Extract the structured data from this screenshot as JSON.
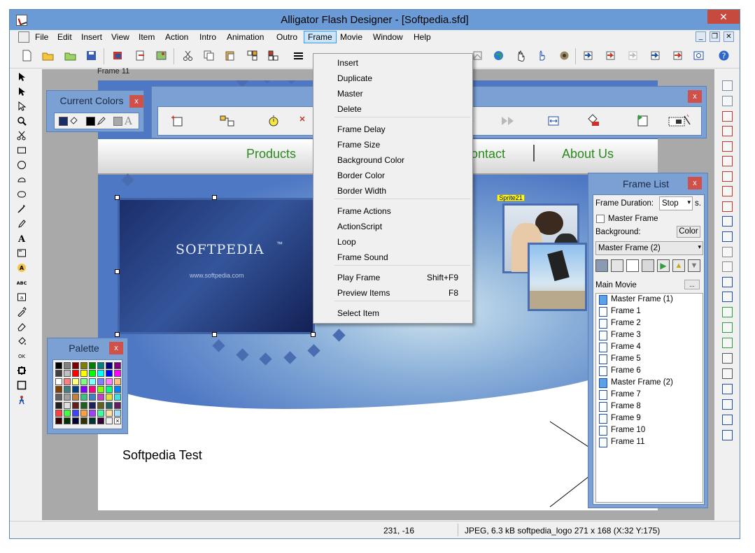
{
  "window": {
    "title": "Alligator Flash Designer - [Softpedia.sfd]",
    "close_glyph": "✕",
    "mdi_minimize": "_",
    "mdi_restore": "❐",
    "mdi_close": "✕"
  },
  "menu": {
    "items": [
      "File",
      "Edit",
      "Insert",
      "View",
      "Item",
      "Action",
      "Intro",
      "Animation",
      "Outro",
      "Frame",
      "Movie",
      "Window",
      "Help"
    ],
    "active": "Frame"
  },
  "frame_menu": {
    "groups": [
      [
        {
          "label": "Insert"
        },
        {
          "label": "Duplicate"
        },
        {
          "label": "Master"
        },
        {
          "label": "Delete"
        }
      ],
      [
        {
          "label": "Frame Delay"
        },
        {
          "label": "Frame Size"
        },
        {
          "label": "Background Color"
        },
        {
          "label": "Border Color"
        },
        {
          "label": "Border Width"
        }
      ],
      [
        {
          "label": "Frame Actions"
        },
        {
          "label": "ActionScript"
        },
        {
          "label": "Loop"
        },
        {
          "label": "Frame Sound"
        }
      ],
      [
        {
          "label": "Play Frame",
          "shortcut": "Shift+F9"
        },
        {
          "label": "Preview Items",
          "shortcut": "F8"
        }
      ],
      [
        {
          "label": "Select Item"
        }
      ]
    ]
  },
  "stage": {
    "frame_label": "Frame 11",
    "nav_links": [
      "Products",
      "Contact",
      "About Us"
    ],
    "sprite_logo": "SOFTPEDIA",
    "sprite_trademark": "™",
    "sprite_url": "www.softpedia.com",
    "sprite_label": "Sprite21",
    "canvas_text": "Softpedia Test"
  },
  "current_colors": {
    "title": "Current Colors",
    "close_glyph": "x",
    "swatches": [
      "#1b2c66",
      "#000000",
      "#a8a8a8"
    ],
    "text_glyph": "A"
  },
  "effects_panel": {
    "close_glyph": "x"
  },
  "palette": {
    "title": "Palette",
    "close_glyph": "x",
    "colors": [
      "#000000",
      "#808080",
      "#800000",
      "#808000",
      "#008000",
      "#008080",
      "#000080",
      "#800080",
      "#404040",
      "#c0c0c0",
      "#ff0000",
      "#ffff00",
      "#00ff00",
      "#00ffff",
      "#0000ff",
      "#ff00ff",
      "#ffffff",
      "#ff8080",
      "#ffff80",
      "#80ff80",
      "#80ffff",
      "#8080ff",
      "#ff80ff",
      "#ffc080",
      "#804000",
      "#408080",
      "#004080",
      "#8000ff",
      "#ff0080",
      "#80ff00",
      "#00ff80",
      "#0080ff",
      "#606060",
      "#a0a0a0",
      "#c08040",
      "#40c080",
      "#4080c0",
      "#c040c0",
      "#e0e040",
      "#40e0e0",
      "#202020",
      "#e0e0e0",
      "#602020",
      "#206020",
      "#202060",
      "#606020",
      "#206060",
      "#602060",
      "#ff4040",
      "#40ff40",
      "#4040ff",
      "#ffa040",
      "#a040ff",
      "#40ffa0",
      "#ffe0a0",
      "#a0e0ff",
      "#300000",
      "#003000",
      "#000030",
      "#303000",
      "#003030",
      "#300030",
      "#f0f0f0"
    ]
  },
  "frame_list": {
    "title": "Frame List",
    "close_glyph": "x",
    "duration_label": "Frame Duration:",
    "duration_value": "Stop",
    "duration_unit": "s.",
    "master_frame_label": "Master Frame",
    "background_label": "Background:",
    "color_button": "Color",
    "master_select": "Master Frame (2)",
    "main_movie_label": "Main Movie",
    "main_movie_button": "...",
    "frames": [
      {
        "label": "Master Frame (1)",
        "master": true
      },
      {
        "label": "Frame 1"
      },
      {
        "label": "Frame 2"
      },
      {
        "label": "Frame 3"
      },
      {
        "label": "Frame 4"
      },
      {
        "label": "Frame 5"
      },
      {
        "label": "Frame 6"
      },
      {
        "label": "Master Frame (2)",
        "master": true
      },
      {
        "label": "Frame 7"
      },
      {
        "label": "Frame 8"
      },
      {
        "label": "Frame 9"
      },
      {
        "label": "Frame 10"
      },
      {
        "label": "Frame 11"
      }
    ]
  },
  "status": {
    "coords": "231, -16",
    "info": "JPEG, 6.3 kB softpedia_logo 271 x 168 (X:32 Y:175)"
  },
  "colors": {
    "titlebar": "#6b9bd6",
    "panel": "#7aa0d4",
    "nav_link": "#2a8a1e",
    "close_red": "#c74a3f"
  }
}
